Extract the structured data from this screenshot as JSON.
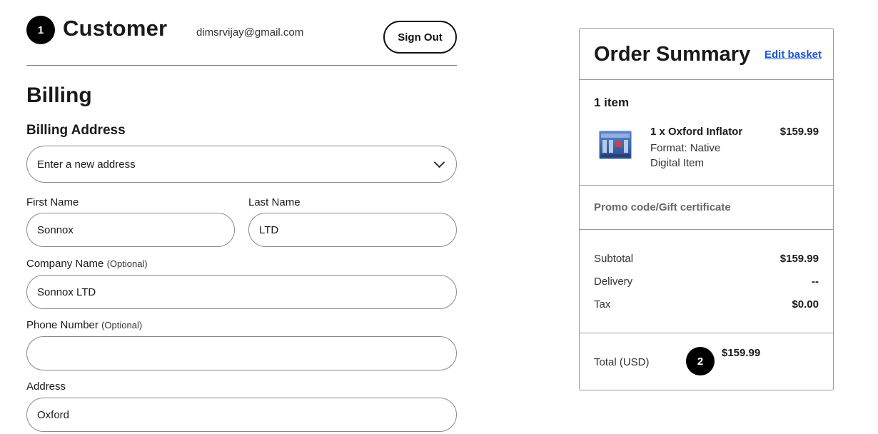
{
  "customer": {
    "step_number": "1",
    "title": "Customer",
    "email": "dimsrvijay@gmail.com",
    "sign_out_label": "Sign Out"
  },
  "billing": {
    "title": "Billing",
    "address_section_label": "Billing Address",
    "address_select_value": "Enter a new address",
    "fields": {
      "first_name": {
        "label": "First Name",
        "value": "Sonnox"
      },
      "last_name": {
        "label": "Last Name",
        "value": "LTD"
      },
      "company_name": {
        "label": "Company Name",
        "optional": "(Optional)",
        "value": "Sonnox LTD"
      },
      "phone_number": {
        "label": "Phone Number",
        "optional": "(Optional)",
        "value": ""
      },
      "address": {
        "label": "Address",
        "value": "Oxford"
      }
    }
  },
  "summary": {
    "title": "Order Summary",
    "edit_label": "Edit basket",
    "items_count": "1 item",
    "item": {
      "name": "1 x Oxford Inflator",
      "format": "Format: Native",
      "type": "Digital Item",
      "price": "$159.99",
      "icon": "product-thumbnail"
    },
    "promo_label": "Promo code/Gift certificate",
    "subtotal_label": "Subtotal",
    "subtotal_value": "$159.99",
    "delivery_label": "Delivery",
    "delivery_value": "--",
    "tax_label": "Tax",
    "tax_value": "$0.00",
    "total_label": "Total (USD)",
    "total_step_number": "2",
    "total_value": "$159.99"
  },
  "colors": {
    "link": "#1a56d6",
    "badge": "#000000",
    "border": "#8a8a8a"
  }
}
